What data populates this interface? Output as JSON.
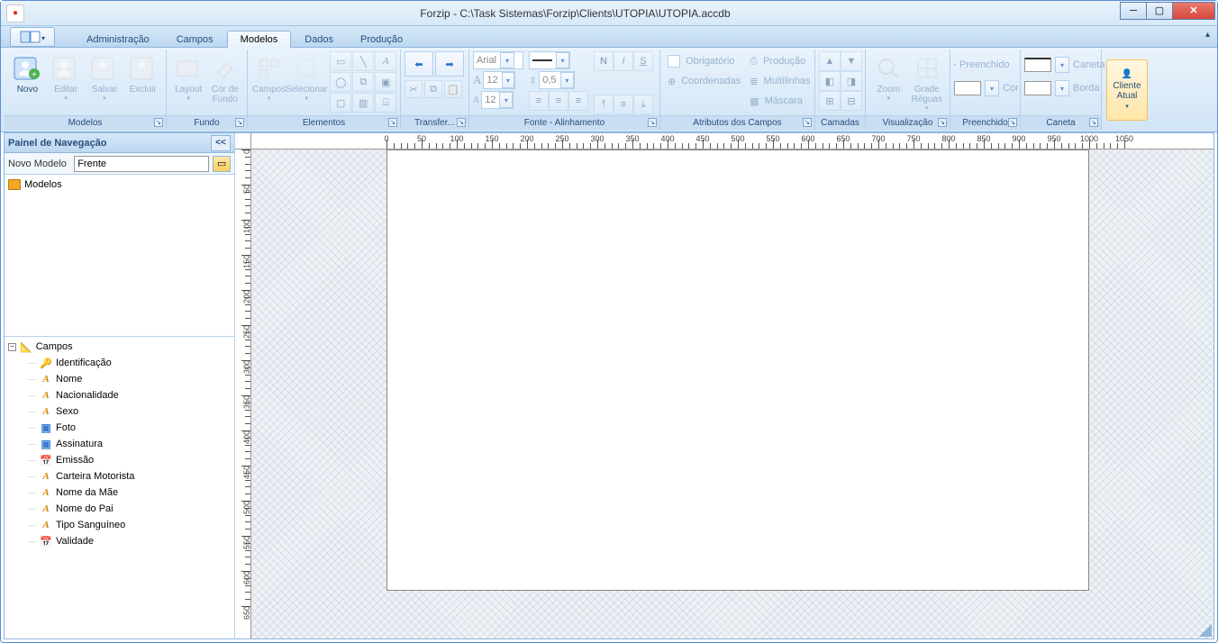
{
  "title": "Forzip - C:\\Task Sistemas\\Forzip\\Clients\\UTOPIA\\UTOPIA.accdb",
  "tabs": {
    "administracao": "Administração",
    "campos": "Campos",
    "modelos": "Modelos",
    "dados": "Dados",
    "producao": "Produção"
  },
  "ribbon": {
    "modelos": {
      "label": "Modelos",
      "novo": "Novo",
      "editar": "Editar",
      "salvar": "Salvar",
      "excluir": "Excluir"
    },
    "fundo": {
      "label": "Fundo",
      "layout": "Layout",
      "cor_de_fundo": "Cor de\nFundo"
    },
    "elementos": {
      "label": "Elementos",
      "campos": "Campos",
      "selecionar": "Selecionar"
    },
    "transferencia": {
      "label": "Transfer..."
    },
    "fonte": {
      "label": "Fonte - Alinhamento",
      "font_name": "Arial",
      "font_size_a": "12",
      "font_size_b": "12",
      "spacing": "0,5"
    },
    "atributos": {
      "label": "Atributos dos Campos",
      "obrigatorio": "Obrigatório",
      "coordenadas": "Coordenadas",
      "producao": "Produção",
      "multilinhas": "Multilinhas",
      "mascara": "Máscara"
    },
    "camadas": {
      "label": "Camadas"
    },
    "visualizacao": {
      "label": "Visualização",
      "zoom": "Zoom",
      "grade_reguas": "Grade\nRéguas"
    },
    "preenchido": {
      "label": "Preenchido",
      "preenchido": "Preenchido",
      "cor": "Cor"
    },
    "caneta": {
      "label": "Caneta",
      "caneta": "Caneta",
      "borda": "Borda"
    },
    "cliente_atual": "Cliente\nAtual"
  },
  "sidepanel": {
    "header": "Painel de Navegação",
    "collapse": "<<",
    "novo_modelo_label": "Novo Modelo",
    "novo_modelo_value": "Frente",
    "modelos_root": "Modelos",
    "campos_root": "Campos",
    "campos": [
      {
        "icon": "key",
        "label": "Identificação"
      },
      {
        "icon": "txt",
        "label": "Nome"
      },
      {
        "icon": "txt",
        "label": "Nacionalidade"
      },
      {
        "icon": "txt",
        "label": "Sexo"
      },
      {
        "icon": "img",
        "label": "Foto"
      },
      {
        "icon": "img",
        "label": "Assinatura"
      },
      {
        "icon": "date",
        "label": "Emissão"
      },
      {
        "icon": "txt",
        "label": "Carteira Motorista"
      },
      {
        "icon": "txt",
        "label": "Nome da Mãe"
      },
      {
        "icon": "txt",
        "label": "Nome do Pai"
      },
      {
        "icon": "txt",
        "label": "Tipo Sanguíneo"
      },
      {
        "icon": "date",
        "label": "Validade"
      }
    ]
  },
  "ruler": {
    "h_majors": [
      0,
      50,
      100,
      150,
      200,
      250,
      300,
      350,
      400,
      450,
      500,
      550,
      600,
      650,
      700,
      750,
      800,
      850,
      900,
      950,
      1000
    ],
    "v_majors": [
      0,
      50,
      100,
      150,
      200,
      250,
      300,
      350,
      400,
      450,
      500,
      550,
      600
    ]
  }
}
